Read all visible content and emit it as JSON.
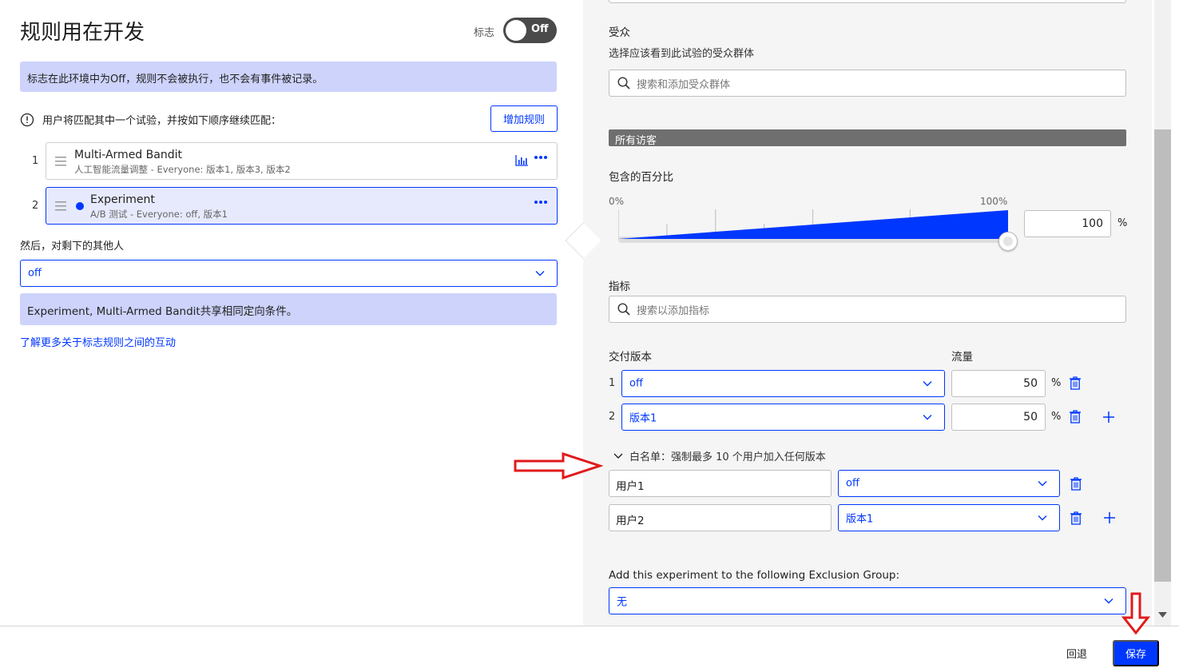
{
  "left": {
    "title": "规则用在开发",
    "flag_label": "标志",
    "toggle_text": "Off",
    "info_banner": "标志在此环境中为Off，规则不会被执行，也不会有事件被记录。",
    "match_text": "用户将匹配其中一个试验，并按如下顺序继续匹配：",
    "add_rule_button": "增加规则",
    "rules": [
      {
        "num": "1",
        "name": "Multi-Armed Bandit",
        "subtitle": "人工智能流量调整 - Everyone: 版本1, 版本3, 版本2"
      },
      {
        "num": "2",
        "name": "Experiment",
        "subtitle": "A/B 测试 - Everyone: off, 版本1"
      }
    ],
    "then_label": "然后，对剩下的其他人",
    "fallback_value": "off",
    "shared_banner": "Experiment, Multi-Armed Bandit共享相同定向条件。",
    "learn_link": "了解更多关于标志规则之间的互动"
  },
  "right": {
    "audience_label": "受众",
    "audience_desc": "选择应该看到此试验的受众群体",
    "audience_placeholder": "搜索和添加受众群体",
    "all_visitors": "所有访客",
    "percent_label": "包含的百分比",
    "slider_min_label": "0%",
    "slider_max_label": "100%",
    "percent_value": "100",
    "percent_sign": "%",
    "metrics_label": "指标",
    "metrics_placeholder": "搜索以添加指标",
    "variations_label": "交付版本",
    "traffic_label": "流量",
    "variations": [
      {
        "num": "1",
        "value": "off",
        "traffic": "50"
      },
      {
        "num": "2",
        "value": "版本1",
        "traffic": "50"
      }
    ],
    "allowlist_label": "白名单：强制最多 10 个用户加入任何版本",
    "allowlist": [
      {
        "user": "用户1",
        "variation": "off"
      },
      {
        "user": "用户2",
        "variation": "版本1"
      }
    ],
    "exclusion_label": "Add this experiment to the following Exclusion Group:",
    "exclusion_value": "无",
    "slider_fill": 1.0
  },
  "footer": {
    "back_button": "回退",
    "save_button": "保存"
  },
  "colors": {
    "accent": "#0037ff",
    "banner": "#cdd3fb",
    "annotation_arrow": "#e01b1b"
  },
  "icons": [
    "drag-handle-icon",
    "more-icon",
    "bar-chart-icon",
    "info-icon",
    "search-icon",
    "chevron-down-icon",
    "trash-icon",
    "plus-icon",
    "annotation-arrow-icon"
  ]
}
